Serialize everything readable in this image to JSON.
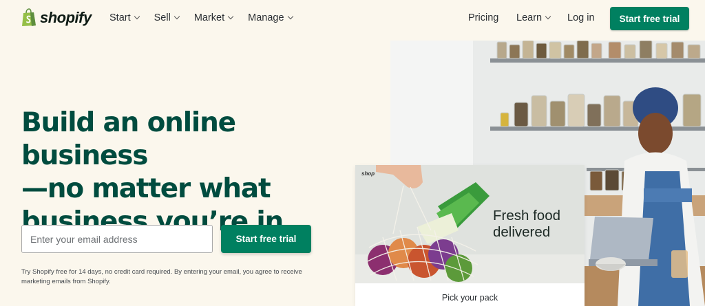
{
  "brand": {
    "name": "shopify"
  },
  "nav": {
    "left": [
      {
        "label": "Start"
      },
      {
        "label": "Sell"
      },
      {
        "label": "Market"
      },
      {
        "label": "Manage"
      }
    ],
    "pricing": "Pricing",
    "learn": "Learn",
    "login": "Log in",
    "cta": "Start free trial"
  },
  "hero": {
    "headline_line1": "Build an online business",
    "headline_line2": "—no matter what",
    "headline_line3": "business you’re in",
    "email_placeholder": "Enter your email address",
    "cta": "Start free trial",
    "disclaimer": "Try Shopify free for 14 days, no credit card required. By entering your email, you agree to receive marketing emails from Shopify."
  },
  "promo_card": {
    "brand": "shop",
    "title_line1": "Fresh food",
    "title_line2": "delivered",
    "footer": "Pick your pack"
  },
  "colors": {
    "accent": "#008060",
    "headline": "#004c3f",
    "background": "#fbf7ed"
  }
}
